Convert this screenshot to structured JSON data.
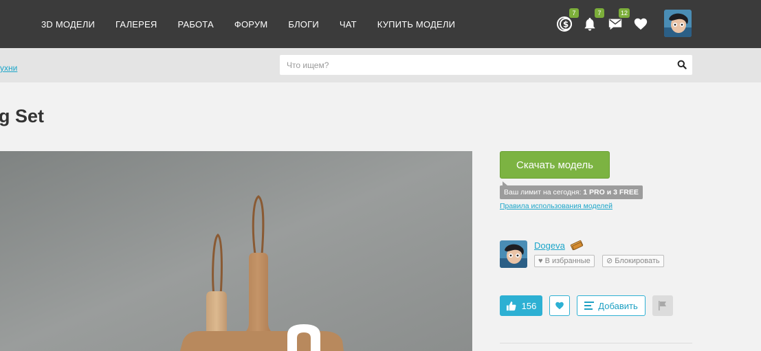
{
  "nav": {
    "items": [
      "3D МОДЕЛИ",
      "ГАЛЕРЕЯ",
      "РАБОТА",
      "ФОРУМ",
      "БЛОГИ",
      "ЧАТ",
      "КУПИТЬ МОДЕЛИ"
    ]
  },
  "header_icons": [
    {
      "icon": "coins-icon",
      "badge": "7"
    },
    {
      "icon": "bell-icon",
      "badge": "7"
    },
    {
      "icon": "messages-icon",
      "badge": "12"
    },
    {
      "icon": "heart-icon",
      "badge": ""
    }
  ],
  "breadcrumb": {
    "text": "ухни"
  },
  "search": {
    "placeholder": "Что ищем?"
  },
  "page": {
    "title": "g Set"
  },
  "download": {
    "button_label": "Скачать модель",
    "limit_prefix": "Ваш лимит на сегодня: ",
    "limit_value": "1 PRO и 3 FREE",
    "rules_link": "Правила использования моделей"
  },
  "author": {
    "name": "Dogeva",
    "fav_label": "В избранные",
    "block_label": "Блокировать"
  },
  "actions": {
    "likes": "156",
    "add_label": "Добавить"
  },
  "colors": {
    "topbar": "#3b3b3b",
    "accent_green": "#7cb342",
    "accent_blue": "#2db0d3",
    "badge_green": "#7cae3a"
  }
}
